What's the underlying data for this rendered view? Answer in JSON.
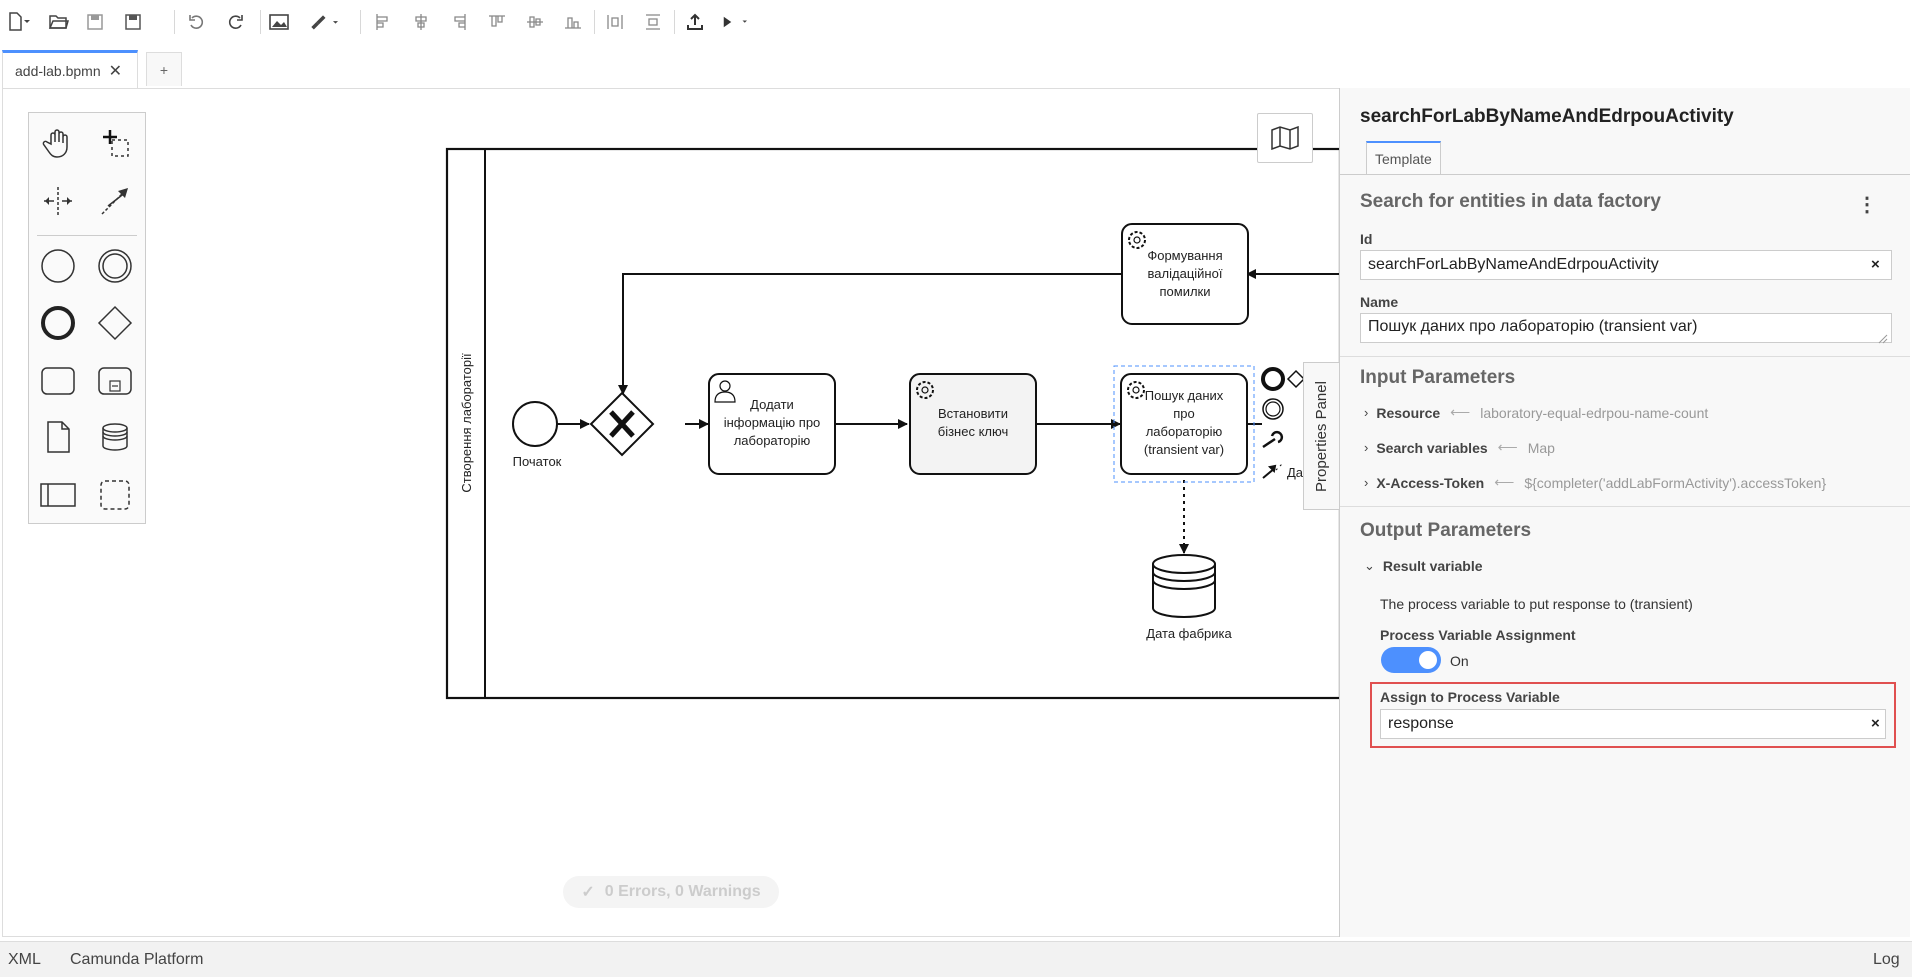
{
  "tabs": [
    {
      "label": "add-lab.bpmn",
      "close": "✕"
    }
  ],
  "add_tab_label": "+",
  "toolbar": {
    "items": [
      "new-file-icon",
      "open-folder-icon",
      "save-icon",
      "save-as-icon",
      "undo-icon",
      "redo-icon",
      "export-image-icon",
      "color-brush-icon",
      "align-left-icon",
      "align-center-icon",
      "align-right-icon",
      "align-top-icon",
      "align-middle-icon",
      "align-bottom-icon",
      "distribute-horizontal-icon",
      "distribute-vertical-icon",
      "deploy-icon",
      "start-instance-icon"
    ]
  },
  "diagram": {
    "pool_label": "Створення лабораторії",
    "start_event": "Початок",
    "task_add_info": [
      "Додати",
      "інформацію про",
      "лабораторію"
    ],
    "task_business_key": [
      "Встановити",
      "бізнес ключ"
    ],
    "task_search": [
      "Пошук даних",
      "про",
      "лабораторію",
      "(transient var)"
    ],
    "task_validation": [
      "Формування",
      "валідаційної",
      "помилки"
    ],
    "data_store": "Дата фабрика",
    "truncated_label": "Да"
  },
  "properties_toggle_label": "Properties Panel",
  "properties": {
    "title": "searchForLabByNameAndEdrpouActivity",
    "tab": "Template",
    "group_title": "Search for entities in data factory",
    "menu": "⋮",
    "id_label": "Id",
    "id_value": "searchForLabByNameAndEdrpouActivity",
    "name_label": "Name",
    "name_value": "Пошук даних про лабораторію (transient var)",
    "clear": "×",
    "input_parameters_title": "Input Parameters",
    "input_parameters": [
      {
        "name": "Resource",
        "value": "laboratory-equal-edrpou-name-count"
      },
      {
        "name": "Search variables",
        "value": "Map"
      },
      {
        "name": "X-Access-Token",
        "value": "${completer('addLabFormActivity').accessToken}"
      }
    ],
    "output_parameters_title": "Output Parameters",
    "result_variable_label": "Result variable",
    "result_description": "The process variable to put response to (transient)",
    "assignment_label": "Process Variable Assignment",
    "toggle_state": "On",
    "assign_label": "Assign to Process Variable",
    "assign_value": "response"
  },
  "lint": {
    "check": "✓",
    "text": "0 Errors, 0 Warnings"
  },
  "statusbar": {
    "xml": "XML",
    "platform": "Camunda Platform",
    "log": "Log"
  },
  "colors": {
    "accent": "#4d90fe",
    "highlight": "#e05050",
    "selection": "#4d90fe"
  }
}
